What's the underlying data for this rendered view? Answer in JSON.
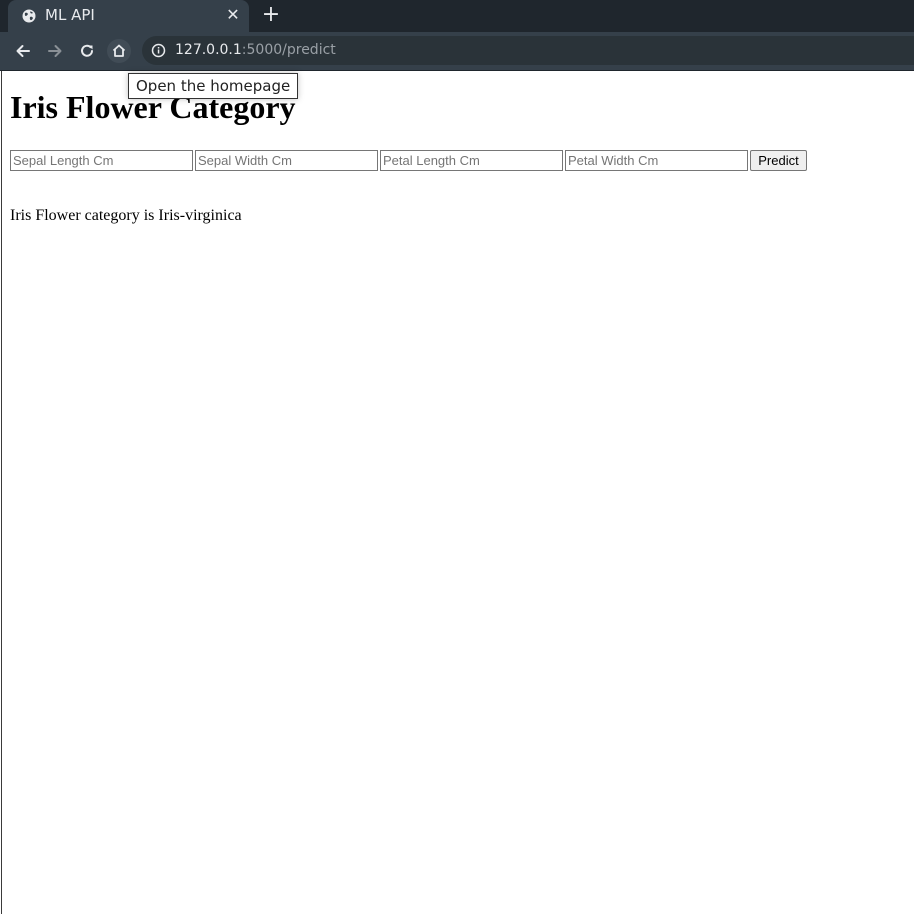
{
  "browser": {
    "tab_title": "ML API",
    "tab_close": "✕",
    "new_tab": "+",
    "url_host": "127.0.0.1",
    "url_path": ":5000/predict",
    "tooltip": "Open the homepage",
    "colors": {
      "tabstrip": "#1f262d",
      "toolbar": "#35404a",
      "omnibox": "#2a3339"
    }
  },
  "page": {
    "title": "Iris Flower Category",
    "form": {
      "sepal_length_placeholder": "Sepal Length Cm",
      "sepal_width_placeholder": "Sepal Width Cm",
      "petal_length_placeholder": "Petal Length Cm",
      "petal_width_placeholder": "Petal Width Cm",
      "sepal_length_value": "",
      "sepal_width_value": "",
      "petal_length_value": "",
      "petal_width_value": "",
      "submit_label": "Predict"
    },
    "result_text": "Iris Flower category is Iris-virginica"
  }
}
